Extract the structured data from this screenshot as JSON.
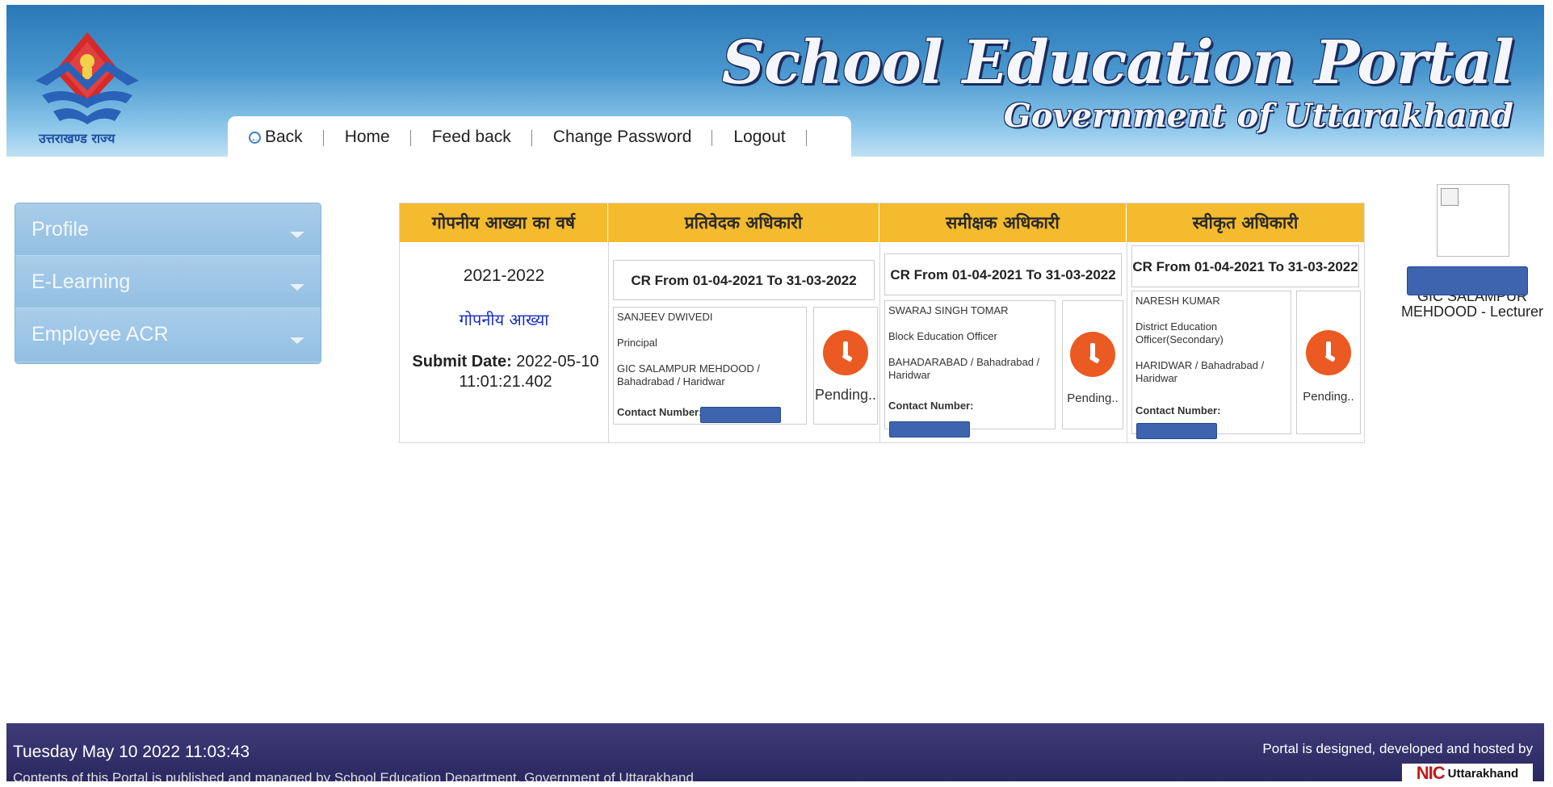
{
  "header": {
    "logo_text": "उत्तराखण्ड राज्य",
    "brand_title": "School Education Portal",
    "brand_subtitle": "Government of Uttarakhand"
  },
  "nav": {
    "back": "Back",
    "home": "Home",
    "feedback": "Feed back",
    "change_password": "Change Password",
    "logout": "Logout"
  },
  "sidebar": {
    "items": [
      {
        "label": "Profile"
      },
      {
        "label": "E-Learning"
      },
      {
        "label": "Employee ACR"
      }
    ]
  },
  "acr_table": {
    "headers": [
      "गोपनीय आख्या का वर्ष",
      "प्रतिवेदक अधिकारी",
      "समीक्षक अधिकारी",
      "स्वीकृत अधिकारी"
    ],
    "year": "2021-2022",
    "acr_link": "गोपनीय आख्या",
    "submit_label": "Submit Date:",
    "submit_date": "2022-05-10",
    "submit_time": "11:01:21.402",
    "officers": [
      {
        "cr_period": "CR From 01-04-2021 To 31-03-2022",
        "name": "SANJEEV DWIVEDI",
        "designation": "Principal",
        "office": "GIC SALAMPUR MEHDOOD / Bahadrabad / Haridwar",
        "contact_label": "Contact Number:",
        "status": "Pending.."
      },
      {
        "cr_period": "CR From 01-04-2021 To 31-03-2022",
        "name": "SWARAJ SINGH TOMAR",
        "designation": "Block Education Officer",
        "office": "BAHADARABAD / Bahadrabad / Haridwar",
        "contact_label": "Contact Number:",
        "status": "Pending.."
      },
      {
        "cr_period": "CR From 01-04-2021 To 31-03-2022",
        "name": "NARESH KUMAR",
        "designation": "District Education Officer(Secondary)",
        "office": "HARIDWAR / Bahadrabad / Haridwar",
        "contact_label": "Contact Number:",
        "status": "Pending.."
      }
    ]
  },
  "employee": {
    "label": "GIC SALAMPUR MEHDOOD - Lecturer"
  },
  "footer": {
    "datetime": "Tuesday May 10 2022 11:03:43",
    "content_note": "Contents of this Portal is published and managed by School Education Department, Government of Uttarakhand",
    "designed_by": "Portal is designed, developed and hosted by",
    "nic_mark": "NIC",
    "nic_place": "Uttarakhand"
  }
}
